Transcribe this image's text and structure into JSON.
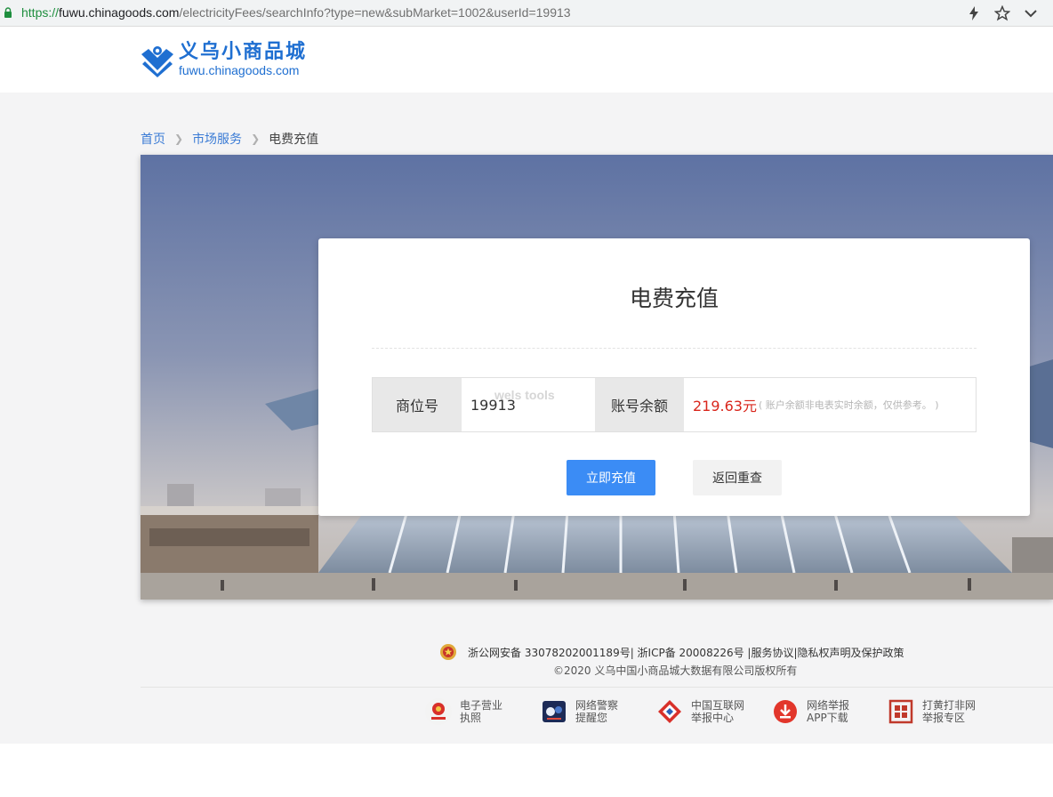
{
  "browser": {
    "url_scheme": "https://",
    "url_host": "fuwu.chinagoods.com",
    "url_path": "/electricityFees/searchInfo?type=new&subMarket=1002&userId=19913",
    "icons": [
      "lightning-icon",
      "star-icon",
      "chevron-down-icon"
    ]
  },
  "header": {
    "logo_cn": "义乌小商品城",
    "logo_en": "fuwu.chinagoods.com",
    "brand_color": "#1f6fd1"
  },
  "breadcrumb": {
    "home": "首页",
    "market": "市场服务",
    "current": "电费充值"
  },
  "card": {
    "title": "电费充值",
    "shop_label": "商位号",
    "shop_value": "19913",
    "watermark": "wels tools",
    "balance_label": "账号余额",
    "balance_amount": "219.63元",
    "balance_note": "( 账户余额非电表实时余额，仅供参考。 )",
    "recharge_button": "立即充值",
    "reset_button": "返回重查",
    "accent_color": "#3b8cf5",
    "amount_color": "#d9261c"
  },
  "footer": {
    "line1": "浙公网安备 33078202001189号| 浙ICP备 20008226号 |服务协议|隐私权声明及保护政策",
    "line2": "©2020 义乌中国小商品城大数据有限公司版权所有",
    "badges": [
      {
        "line1": "电子营业",
        "line2": "执照",
        "icon": "business-license-icon"
      },
      {
        "line1": "网络警察",
        "line2": "提醒您",
        "icon": "cyber-police-icon"
      },
      {
        "line1": "中国互联网",
        "line2": "举报中心",
        "icon": "report-center-icon"
      },
      {
        "line1": "网络举报",
        "line2": "APP下载",
        "icon": "download-app-icon"
      },
      {
        "line1": "打黄打非网",
        "line2": "举报专区",
        "icon": "anti-porn-seal-icon"
      }
    ]
  }
}
